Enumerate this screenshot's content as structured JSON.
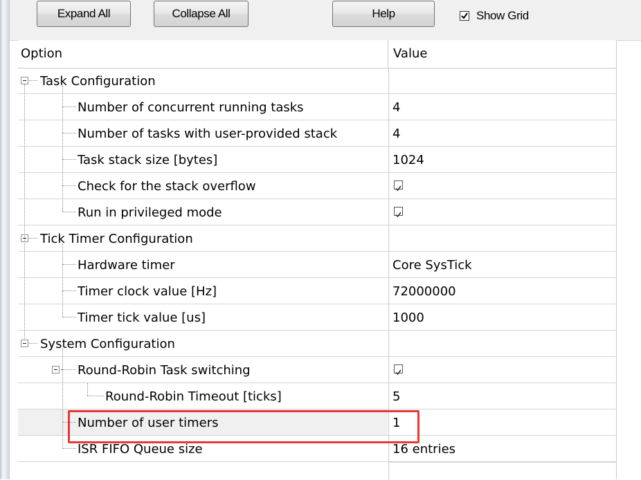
{
  "toolbar": {
    "expand_all": "Expand All",
    "collapse_all": "Collapse All",
    "help": "Help",
    "show_grid_label": "Show Grid",
    "show_grid_checked": true
  },
  "header": {
    "option": "Option",
    "value": "Value"
  },
  "rows": [
    {
      "label": "Task Configuration",
      "value": "",
      "type": "group",
      "level": 0
    },
    {
      "label": "Number of concurrent running tasks",
      "value": "4",
      "type": "text",
      "level": 1
    },
    {
      "label": "Number of tasks with user-provided stack",
      "value": "4",
      "type": "text",
      "level": 1
    },
    {
      "label": "Task stack size [bytes]",
      "value": "1024",
      "type": "text",
      "level": 1
    },
    {
      "label": "Check for the stack overflow",
      "value": "",
      "type": "checkbox",
      "checked": true,
      "level": 1
    },
    {
      "label": "Run in privileged mode",
      "value": "",
      "type": "checkbox",
      "checked": true,
      "level": 1
    },
    {
      "label": "Tick Timer Configuration",
      "value": "",
      "type": "group",
      "level": 0
    },
    {
      "label": "Hardware timer",
      "value": "Core SysTick",
      "type": "text",
      "level": 1
    },
    {
      "label": "Timer clock value [Hz]",
      "value": "72000000",
      "type": "text",
      "level": 1
    },
    {
      "label": "Timer tick value [us]",
      "value": "1000",
      "type": "text",
      "level": 1
    },
    {
      "label": "System Configuration",
      "value": "",
      "type": "group",
      "level": 0
    },
    {
      "label": "Round-Robin Task switching",
      "value": "",
      "type": "checkbox",
      "checked": true,
      "level": 1,
      "expandable": true
    },
    {
      "label": "Round-Robin Timeout [ticks]",
      "value": "5",
      "type": "text",
      "level": 2
    },
    {
      "label": "Number of user timers",
      "value": "1",
      "type": "text",
      "level": 1,
      "selected": true
    },
    {
      "label": "ISR FIFO Queue size",
      "value": "16 entries",
      "type": "text",
      "level": 1
    }
  ],
  "colors": {
    "highlight": "#e53935",
    "grid": "#c8c8c8",
    "toolbar_bg": "#f0f0f0"
  },
  "icons": {
    "expander": "minus-box-icon",
    "check": "check-icon"
  }
}
